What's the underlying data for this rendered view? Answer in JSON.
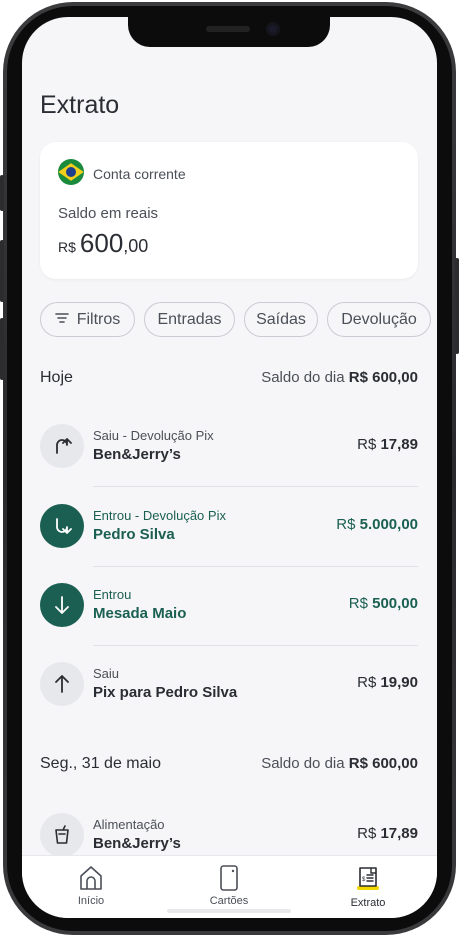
{
  "page": {
    "title": "Extrato"
  },
  "account": {
    "name": "Conta corrente",
    "balance_label": "Saldo em reais",
    "currency": "R$",
    "balance_int": "600",
    "balance_cents": ",00"
  },
  "filters": [
    {
      "label": "Filtros"
    },
    {
      "label": "Entradas"
    },
    {
      "label": "Saídas"
    },
    {
      "label": "Devolução"
    }
  ],
  "days": [
    {
      "label": "Hoje",
      "balance_prefix": "Saldo do dia ",
      "balance_value": "R$ 600,00",
      "transactions": [
        {
          "category": "Saiu - Devolução Pix",
          "name": "Ben&Jerry’s",
          "currency": "R$ ",
          "amount": "17,89",
          "direction": "out",
          "icon": "return-out-icon"
        },
        {
          "category": "Entrou - Devolução Pix",
          "name": "Pedro Silva",
          "currency": "R$ ",
          "amount": "5.000,00",
          "direction": "in",
          "icon": "return-in-icon"
        },
        {
          "category": "Entrou",
          "name": "Mesada Maio",
          "currency": "R$ ",
          "amount": "500,00",
          "direction": "in",
          "icon": "arrow-down-icon"
        },
        {
          "category": "Saiu",
          "name": "Pix para Pedro Silva",
          "currency": "R$ ",
          "amount": "19,90",
          "direction": "out",
          "icon": "arrow-up-icon"
        }
      ]
    },
    {
      "label": "Seg., 31 de maio",
      "balance_prefix": "Saldo do dia ",
      "balance_value": "R$ 600,00",
      "transactions": [
        {
          "category": "Alimentação",
          "name": "Ben&Jerry’s",
          "currency": "R$ ",
          "amount": "17,89",
          "direction": "out",
          "icon": "cup-icon"
        }
      ]
    }
  ],
  "tabs": [
    {
      "label": "Início",
      "icon": "home-icon",
      "active": false
    },
    {
      "label": "Cartões",
      "icon": "card-icon",
      "active": false
    },
    {
      "label": "Extrato",
      "icon": "receipt-icon",
      "active": true
    }
  ],
  "colors": {
    "accent_green": "#1a5f52",
    "active_tab_highlight": "#f2d600",
    "background": "#f6f6f8"
  }
}
